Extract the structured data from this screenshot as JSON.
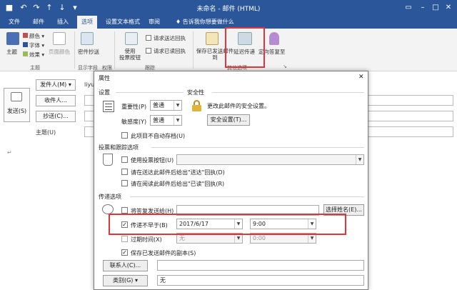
{
  "window": {
    "title": "未命名 - 邮件 (HTML)"
  },
  "tabs": [
    "文件",
    "邮件",
    "插入",
    "选项",
    "设置文本格式",
    "审阅"
  ],
  "tell_me": "告诉我你想要做什么",
  "ribbon": {
    "theme_label": "主题",
    "colors_label": "颜色",
    "fonts_label": "字体",
    "effects_label": "效果",
    "page_color_label": "页面颜色",
    "bcc_label": "密件抄送",
    "use_voting_label": "使用\n投票按钮",
    "request_delivery_label": "请求送达回执",
    "request_read_label": "请求已读回执",
    "save_sent_label": "保存已发送邮件到",
    "delay_delivery_label": "延迟传递",
    "direct_replies_label": "定向答复至",
    "group_theme": "主题",
    "group_show_fields": "显示字段",
    "group_permission": "权限",
    "group_tracking": "跟踪",
    "group_more_options": "其他选项"
  },
  "compose": {
    "send_label": "发送(S)",
    "from_label": "发件人(M) ▾",
    "from_value": "liyu",
    "to_label": "收件人...",
    "cc_label": "抄送(C)...",
    "subject_label": "主题(U)",
    "body_mark": "↵"
  },
  "dialog": {
    "title": "属性",
    "settings_section": "设置",
    "security_section": "安全性",
    "importance_label": "重要性(P)",
    "importance_value": "普通",
    "sensitivity_label": "敏感度(Y)",
    "sensitivity_value": "普通",
    "security_text": "更改此邮件的安全设置。",
    "security_button": "安全设置(T)...",
    "no_autoarchive_label": "此项目不自动存档(U)",
    "voting_section": "投票和跟踪选项",
    "use_voting_buttons_label": "使用投票按钮(U)",
    "request_delivery_receipt_label": "请在送达此邮件后给出\"送达\"回执(D)",
    "request_read_receipt_label": "请在阅读此邮件后给出\"已读\"回执(R)",
    "delivery_section": "传递选项",
    "have_replies_sent_label": "将答复发送给(H)",
    "select_names_button": "选择姓名(E)...",
    "do_not_deliver_label": "传递不早于(B)",
    "deliver_date": "2017/6/17",
    "deliver_time": "9:00",
    "expires_label": "过期时间(X)",
    "expires_date": "无",
    "expires_time": "0:00",
    "save_copy_label": "保存已发送邮件的副本(S)",
    "contacts_button": "联系人(C)...",
    "categories_button": "类别(G)",
    "categories_value": "无"
  },
  "colors": {
    "brand": "#2b579a",
    "highlight": "#e0363b"
  }
}
